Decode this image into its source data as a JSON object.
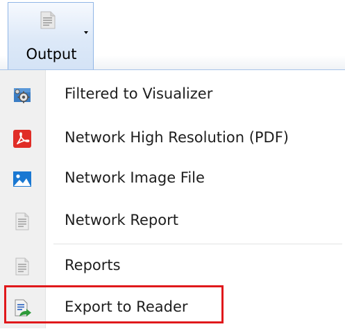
{
  "ribbon": {
    "output_button": {
      "label": "Output",
      "icon": "document-icon"
    }
  },
  "menu": {
    "items": [
      {
        "label": "Filtered to Visualizer",
        "icon": "visualizer-gear-icon"
      },
      {
        "label": "Network High Resolution (PDF)",
        "icon": "pdf-icon"
      },
      {
        "label": "Network Image File",
        "icon": "image-icon"
      },
      {
        "label": "Network Report",
        "icon": "document-icon"
      },
      {
        "label": "Reports",
        "icon": "document-icon"
      },
      {
        "label": "Export to Reader",
        "icon": "export-arrow-icon"
      }
    ]
  },
  "colors": {
    "button_border": "#8fb5e6",
    "gutter": "#f0f0f0",
    "pdf_red": "#e02d27",
    "image_blue": "#1a78d2",
    "highlight_red": "#e0181b"
  }
}
